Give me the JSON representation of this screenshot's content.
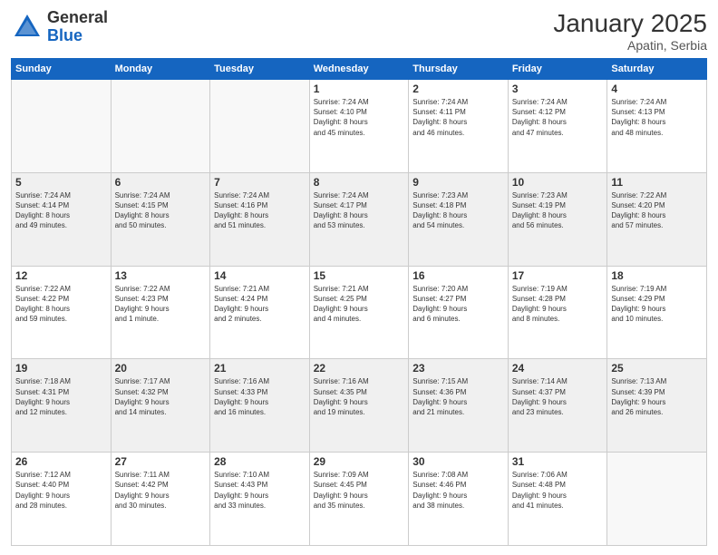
{
  "logo": {
    "general": "General",
    "blue": "Blue"
  },
  "header": {
    "month": "January 2025",
    "location": "Apatin, Serbia"
  },
  "weekdays": [
    "Sunday",
    "Monday",
    "Tuesday",
    "Wednesday",
    "Thursday",
    "Friday",
    "Saturday"
  ],
  "weeks": [
    [
      {
        "day": "",
        "info": ""
      },
      {
        "day": "",
        "info": ""
      },
      {
        "day": "",
        "info": ""
      },
      {
        "day": "1",
        "info": "Sunrise: 7:24 AM\nSunset: 4:10 PM\nDaylight: 8 hours\nand 45 minutes."
      },
      {
        "day": "2",
        "info": "Sunrise: 7:24 AM\nSunset: 4:11 PM\nDaylight: 8 hours\nand 46 minutes."
      },
      {
        "day": "3",
        "info": "Sunrise: 7:24 AM\nSunset: 4:12 PM\nDaylight: 8 hours\nand 47 minutes."
      },
      {
        "day": "4",
        "info": "Sunrise: 7:24 AM\nSunset: 4:13 PM\nDaylight: 8 hours\nand 48 minutes."
      }
    ],
    [
      {
        "day": "5",
        "info": "Sunrise: 7:24 AM\nSunset: 4:14 PM\nDaylight: 8 hours\nand 49 minutes."
      },
      {
        "day": "6",
        "info": "Sunrise: 7:24 AM\nSunset: 4:15 PM\nDaylight: 8 hours\nand 50 minutes."
      },
      {
        "day": "7",
        "info": "Sunrise: 7:24 AM\nSunset: 4:16 PM\nDaylight: 8 hours\nand 51 minutes."
      },
      {
        "day": "8",
        "info": "Sunrise: 7:24 AM\nSunset: 4:17 PM\nDaylight: 8 hours\nand 53 minutes."
      },
      {
        "day": "9",
        "info": "Sunrise: 7:23 AM\nSunset: 4:18 PM\nDaylight: 8 hours\nand 54 minutes."
      },
      {
        "day": "10",
        "info": "Sunrise: 7:23 AM\nSunset: 4:19 PM\nDaylight: 8 hours\nand 56 minutes."
      },
      {
        "day": "11",
        "info": "Sunrise: 7:22 AM\nSunset: 4:20 PM\nDaylight: 8 hours\nand 57 minutes."
      }
    ],
    [
      {
        "day": "12",
        "info": "Sunrise: 7:22 AM\nSunset: 4:22 PM\nDaylight: 8 hours\nand 59 minutes."
      },
      {
        "day": "13",
        "info": "Sunrise: 7:22 AM\nSunset: 4:23 PM\nDaylight: 9 hours\nand 1 minute."
      },
      {
        "day": "14",
        "info": "Sunrise: 7:21 AM\nSunset: 4:24 PM\nDaylight: 9 hours\nand 2 minutes."
      },
      {
        "day": "15",
        "info": "Sunrise: 7:21 AM\nSunset: 4:25 PM\nDaylight: 9 hours\nand 4 minutes."
      },
      {
        "day": "16",
        "info": "Sunrise: 7:20 AM\nSunset: 4:27 PM\nDaylight: 9 hours\nand 6 minutes."
      },
      {
        "day": "17",
        "info": "Sunrise: 7:19 AM\nSunset: 4:28 PM\nDaylight: 9 hours\nand 8 minutes."
      },
      {
        "day": "18",
        "info": "Sunrise: 7:19 AM\nSunset: 4:29 PM\nDaylight: 9 hours\nand 10 minutes."
      }
    ],
    [
      {
        "day": "19",
        "info": "Sunrise: 7:18 AM\nSunset: 4:31 PM\nDaylight: 9 hours\nand 12 minutes."
      },
      {
        "day": "20",
        "info": "Sunrise: 7:17 AM\nSunset: 4:32 PM\nDaylight: 9 hours\nand 14 minutes."
      },
      {
        "day": "21",
        "info": "Sunrise: 7:16 AM\nSunset: 4:33 PM\nDaylight: 9 hours\nand 16 minutes."
      },
      {
        "day": "22",
        "info": "Sunrise: 7:16 AM\nSunset: 4:35 PM\nDaylight: 9 hours\nand 19 minutes."
      },
      {
        "day": "23",
        "info": "Sunrise: 7:15 AM\nSunset: 4:36 PM\nDaylight: 9 hours\nand 21 minutes."
      },
      {
        "day": "24",
        "info": "Sunrise: 7:14 AM\nSunset: 4:37 PM\nDaylight: 9 hours\nand 23 minutes."
      },
      {
        "day": "25",
        "info": "Sunrise: 7:13 AM\nSunset: 4:39 PM\nDaylight: 9 hours\nand 26 minutes."
      }
    ],
    [
      {
        "day": "26",
        "info": "Sunrise: 7:12 AM\nSunset: 4:40 PM\nDaylight: 9 hours\nand 28 minutes."
      },
      {
        "day": "27",
        "info": "Sunrise: 7:11 AM\nSunset: 4:42 PM\nDaylight: 9 hours\nand 30 minutes."
      },
      {
        "day": "28",
        "info": "Sunrise: 7:10 AM\nSunset: 4:43 PM\nDaylight: 9 hours\nand 33 minutes."
      },
      {
        "day": "29",
        "info": "Sunrise: 7:09 AM\nSunset: 4:45 PM\nDaylight: 9 hours\nand 35 minutes."
      },
      {
        "day": "30",
        "info": "Sunrise: 7:08 AM\nSunset: 4:46 PM\nDaylight: 9 hours\nand 38 minutes."
      },
      {
        "day": "31",
        "info": "Sunrise: 7:06 AM\nSunset: 4:48 PM\nDaylight: 9 hours\nand 41 minutes."
      },
      {
        "day": "",
        "info": ""
      }
    ]
  ]
}
